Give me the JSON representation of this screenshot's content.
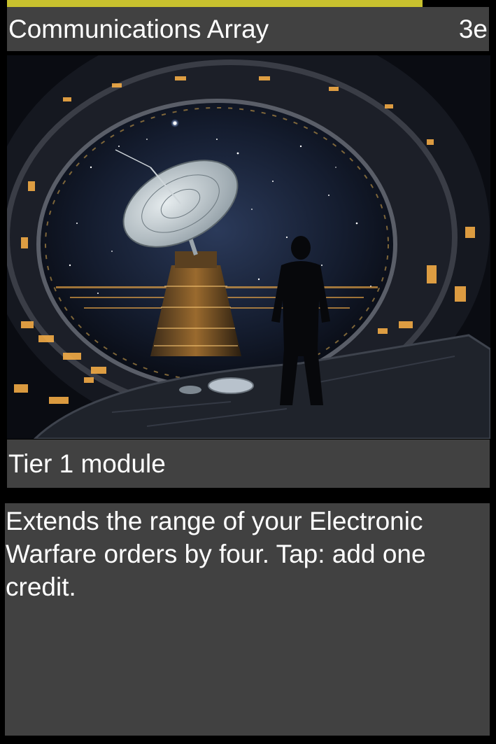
{
  "card": {
    "title": "Communications Array",
    "cost": "3e",
    "type_line": "Tier 1 module",
    "rules_text": "Extends the range of your Electronic Warfare orders by four. Tap: add one credit."
  },
  "artwork": {
    "subject": "astronaut-silhouette-and-satellite-dish",
    "colors": {
      "accent": "#c8c12e",
      "panel": "#414141",
      "background": "#000000",
      "space": "#1a2338",
      "window_light": "#ffb347"
    }
  }
}
